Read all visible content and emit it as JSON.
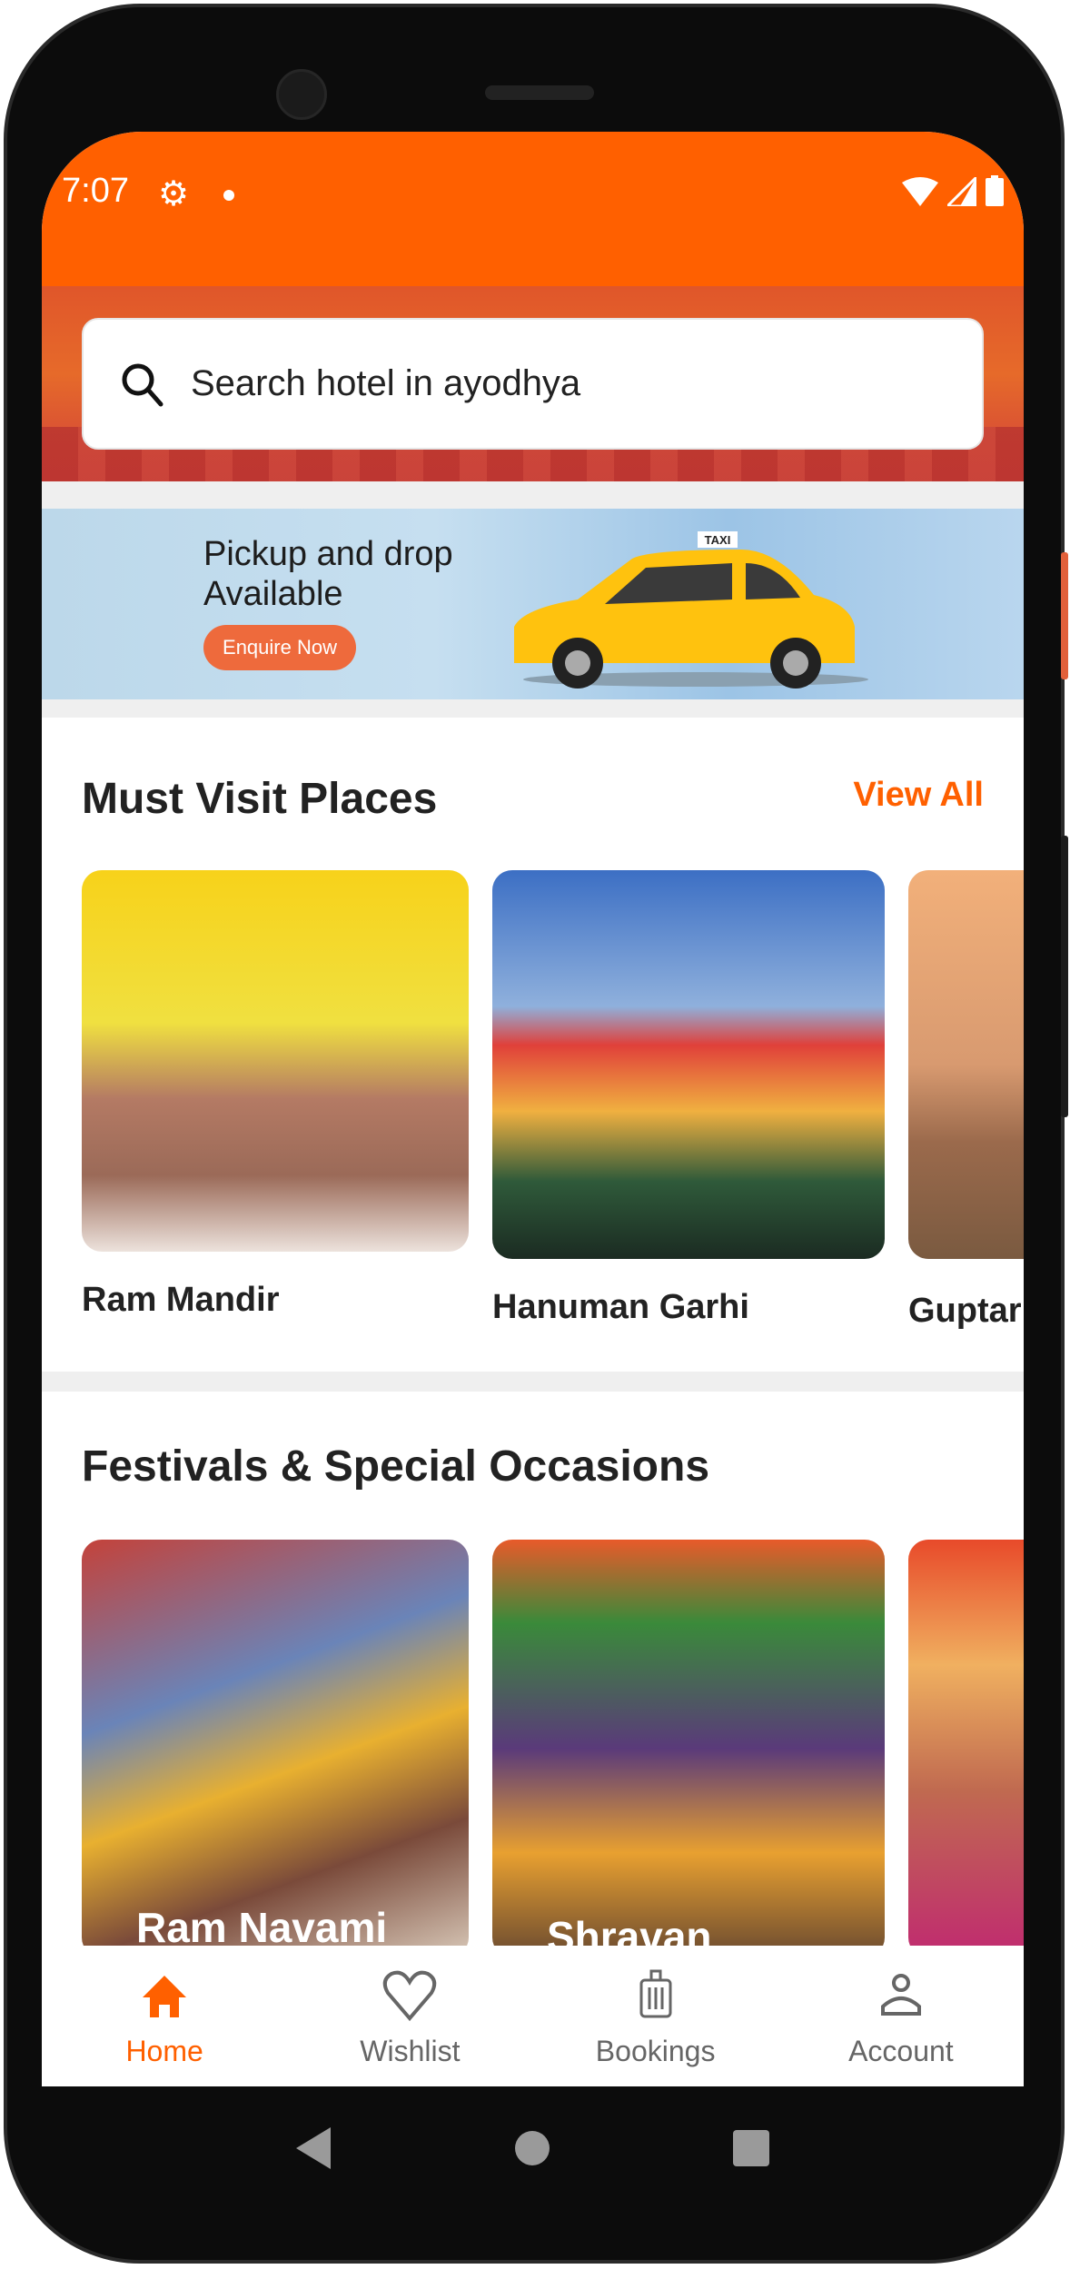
{
  "status_bar": {
    "time": "7:07",
    "icons": [
      "gear-icon",
      "notification-dot",
      "wifi-icon",
      "signal-icon",
      "battery-icon"
    ]
  },
  "search": {
    "placeholder": "Search hotel in ayodhya"
  },
  "banner": {
    "line1": "Pickup and drop",
    "line2": "Available",
    "button": "Enquire Now",
    "taxi_sign": "TAXI"
  },
  "must_visit": {
    "title": "Must Visit Places",
    "view_all": "View All",
    "places": [
      {
        "name": "Ram Mandir"
      },
      {
        "name": "Hanuman Garhi"
      },
      {
        "name": "Guptar"
      }
    ]
  },
  "festivals": {
    "title": "Festivals & Special Occasions",
    "items": [
      {
        "name": "Ram Navami"
      },
      {
        "name": "Shravan"
      },
      {
        "name": ""
      }
    ]
  },
  "bottom_nav": {
    "items": [
      {
        "label": "Home",
        "icon": "home-icon",
        "active": true
      },
      {
        "label": "Wishlist",
        "icon": "heart-icon"
      },
      {
        "label": "Bookings",
        "icon": "luggage-icon"
      },
      {
        "label": "Account",
        "icon": "person-icon"
      }
    ]
  },
  "colors": {
    "accent": "#ff6000",
    "enquire": "#ee6a3c",
    "inactive": "#666666"
  }
}
